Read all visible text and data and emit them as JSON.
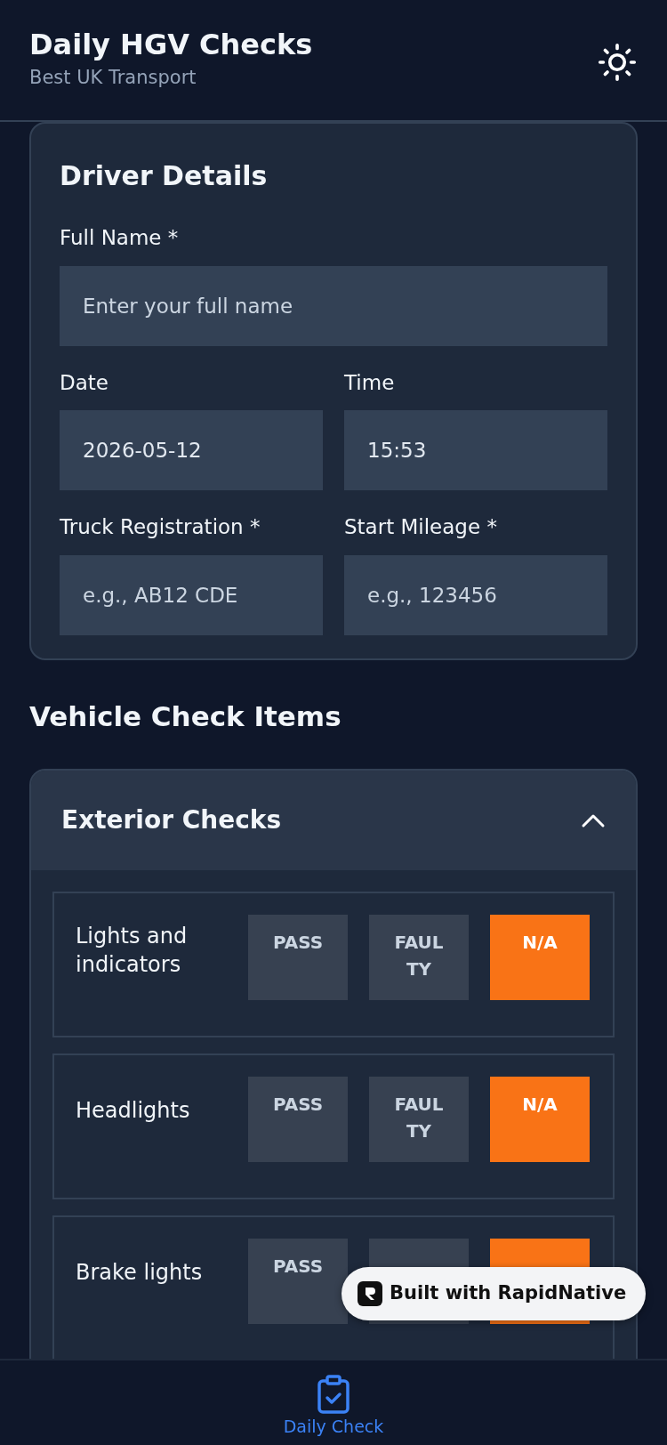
{
  "header": {
    "title": "Daily HGV Checks",
    "subtitle": "Best UK Transport"
  },
  "driver_details": {
    "title": "Driver Details",
    "fields": [
      {
        "label": "Full Name *",
        "placeholder": "Enter your full name",
        "kind": "full"
      },
      {
        "label": "Date",
        "value": "2026-05-12",
        "kind": "half"
      },
      {
        "label": "Time",
        "value": "15:53",
        "kind": "half"
      },
      {
        "label": "Truck Registration *",
        "placeholder": "e.g., AB12 CDE",
        "kind": "half"
      },
      {
        "label": "Start Mileage *",
        "placeholder": "e.g., 123456",
        "kind": "half"
      }
    ]
  },
  "section_title": "Vehicle Check Items",
  "groups": [
    {
      "title": "Exterior Checks",
      "expanded": true,
      "items": [
        {
          "name": "Lights and indicators",
          "options": [
            {
              "label": "PASS",
              "selected": false
            },
            {
              "label": "FAULTY",
              "selected": false
            },
            {
              "label": "N/A",
              "selected": true
            }
          ]
        },
        {
          "name": "Headlights",
          "options": [
            {
              "label": "PASS",
              "selected": false
            },
            {
              "label": "FAULTY",
              "selected": false
            },
            {
              "label": "N/A",
              "selected": true
            }
          ]
        },
        {
          "name": "Brake lights",
          "options": [
            {
              "label": "PASS",
              "selected": false
            },
            {
              "selected": false
            },
            {
              "selected": true
            }
          ]
        }
      ]
    }
  ],
  "badge": {
    "text": "Built with RapidNative"
  },
  "bottom_nav": [
    {
      "label": "Daily Check",
      "selected": true
    }
  ]
}
